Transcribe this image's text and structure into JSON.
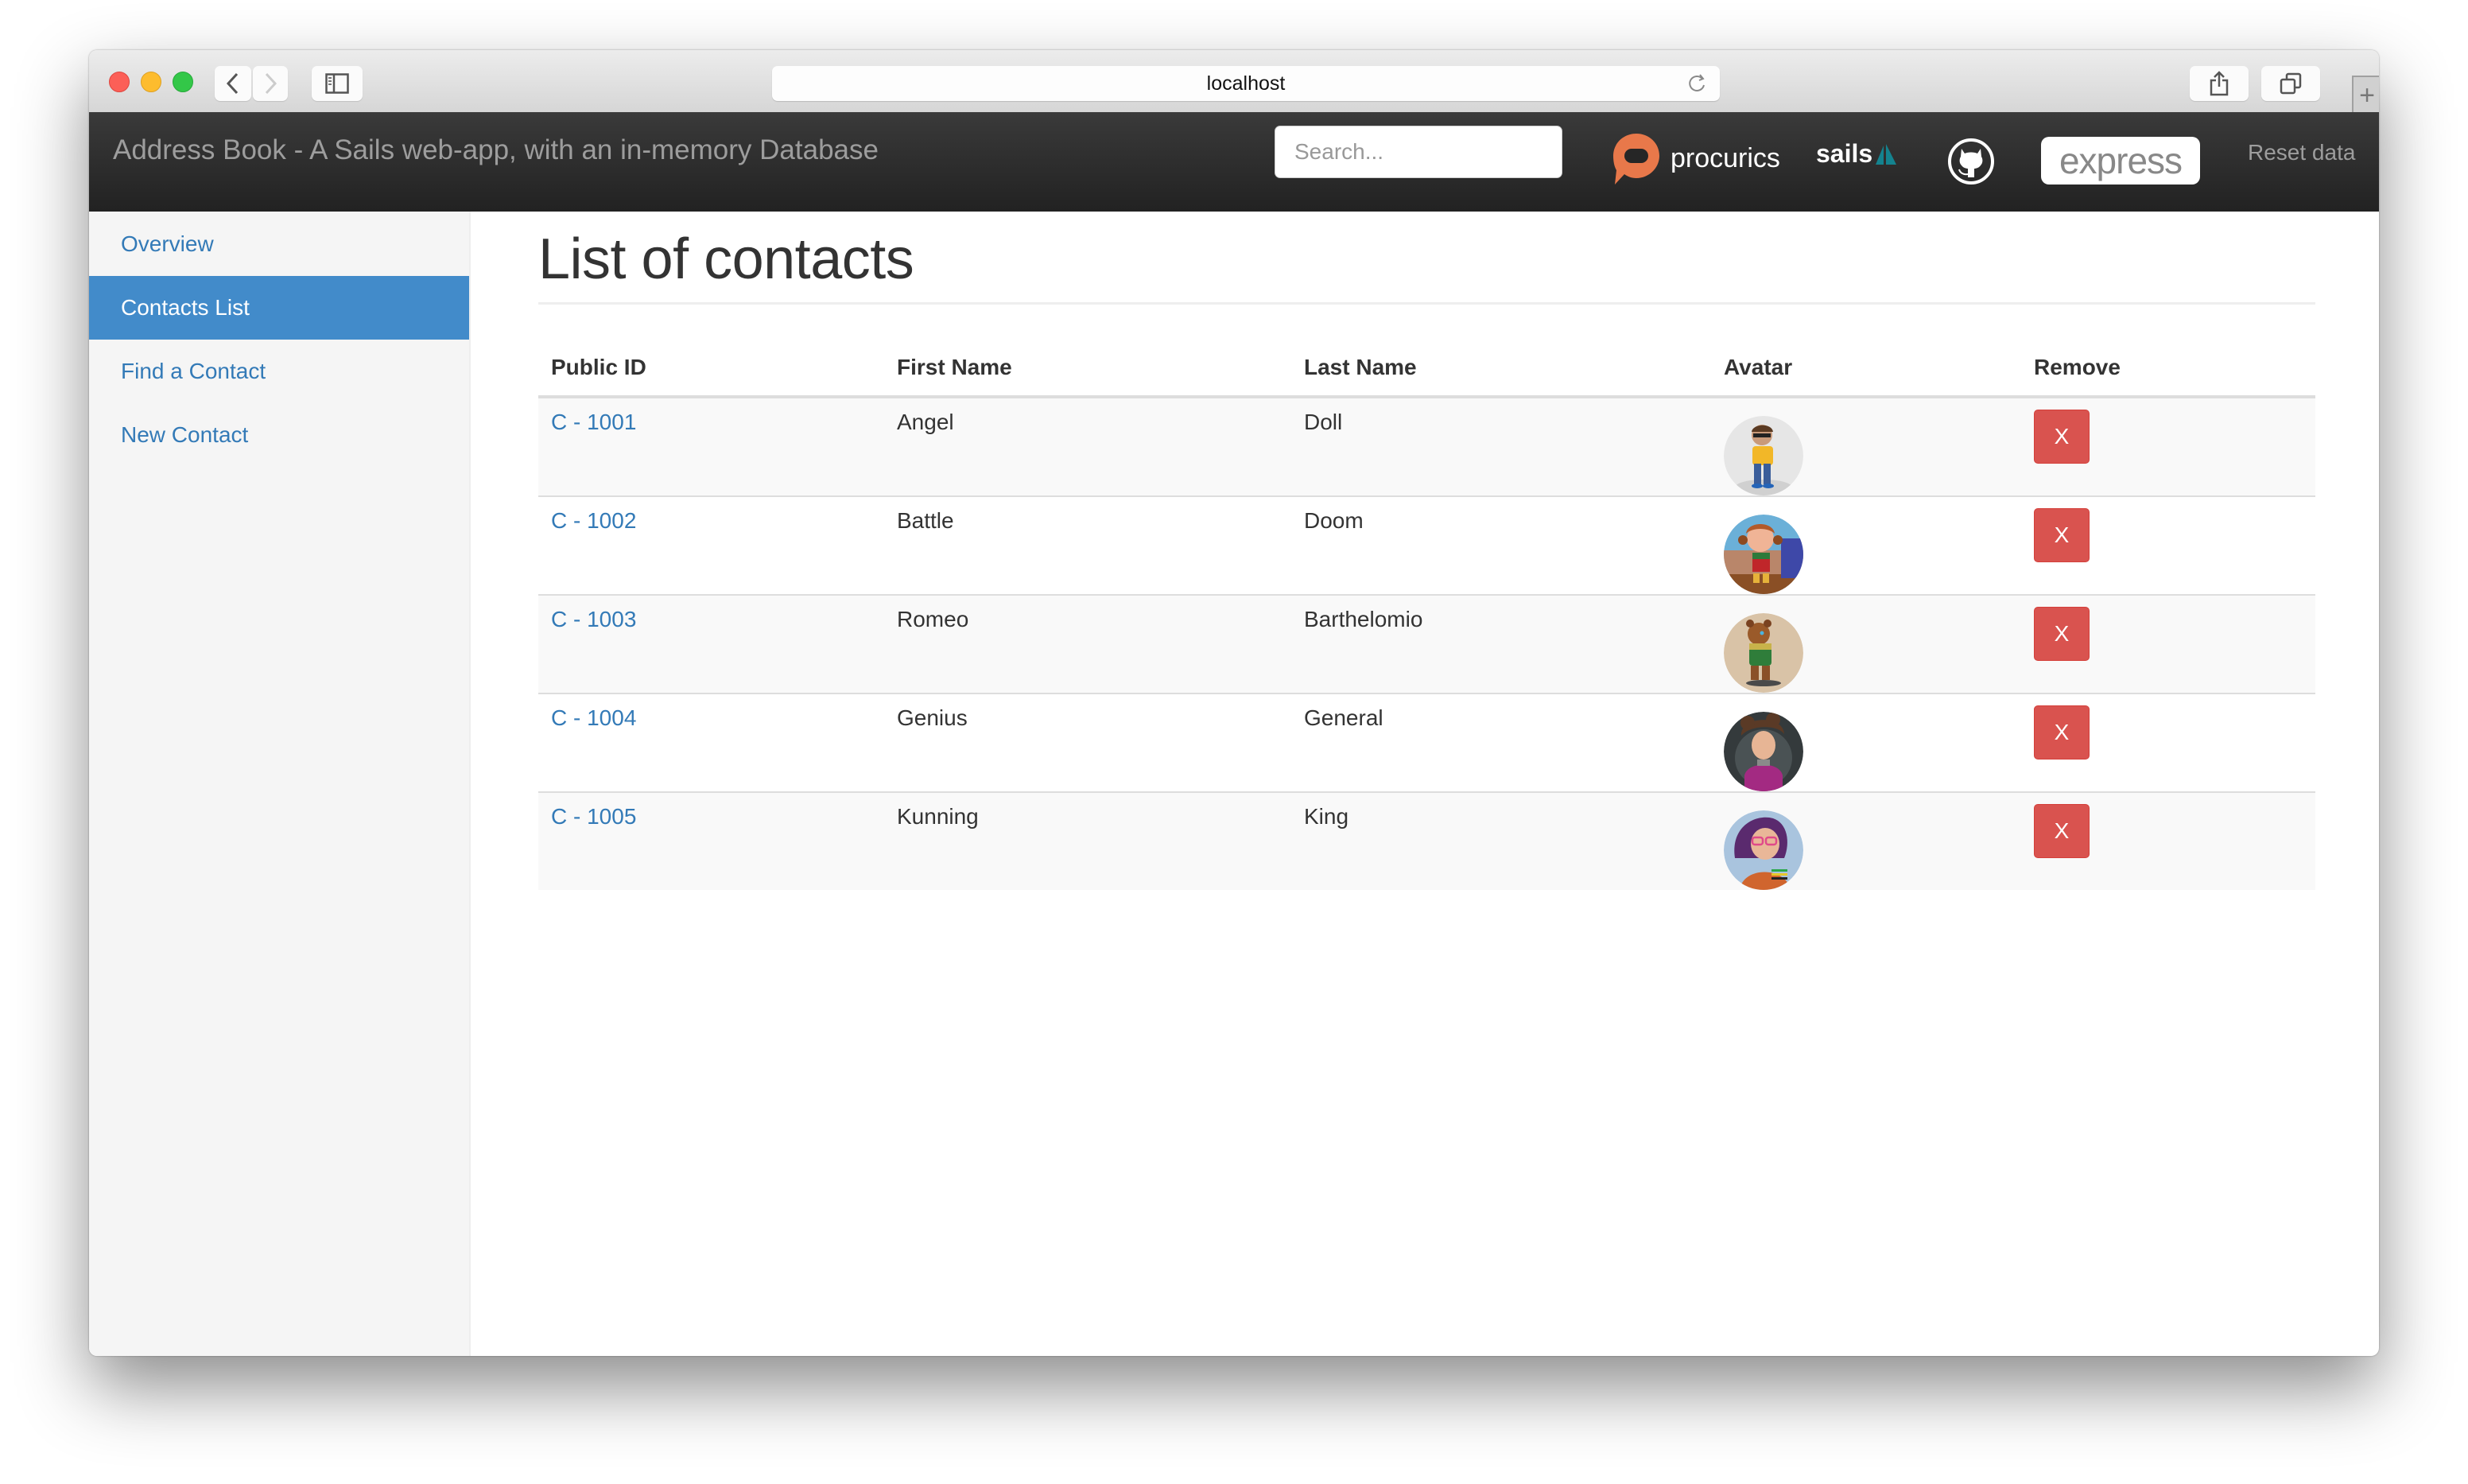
{
  "browser": {
    "url": "localhost",
    "new_tab_label": "+"
  },
  "navbar": {
    "brand": "Address Book - A Sails web-app, with an in-memory Database",
    "search_placeholder": "Search...",
    "search_value": "",
    "logos": {
      "procurics": "procurics",
      "sails": "sails",
      "github": "github",
      "express": "express"
    },
    "reset_label": "Reset data",
    "colors": {
      "procurics_orange": "#e8784a",
      "sails_teal": "#14838f"
    }
  },
  "sidebar": {
    "items": [
      {
        "label": "Overview",
        "active": false
      },
      {
        "label": "Contacts List",
        "active": true
      },
      {
        "label": "Find a Contact",
        "active": false
      },
      {
        "label": "New Contact",
        "active": false
      }
    ],
    "active_color": "#428bca"
  },
  "main": {
    "title": "List of contacts",
    "table": {
      "columns": [
        "Public ID",
        "First Name",
        "Last Name",
        "Avatar",
        "Remove"
      ],
      "rows": [
        {
          "id": "C - 1001",
          "first": "Angel",
          "last": "Doll",
          "avatar": "boy-glasses-yellow-shirt",
          "remove": "X"
        },
        {
          "id": "C - 1002",
          "first": "Battle",
          "last": "Doom",
          "avatar": "girl-pigtails-blue-room",
          "remove": "X"
        },
        {
          "id": "C - 1003",
          "first": "Romeo",
          "last": "Barthelomio",
          "avatar": "bear-green-outfit",
          "remove": "X"
        },
        {
          "id": "C - 1004",
          "first": "Genius",
          "last": "General",
          "avatar": "girl-curly-hair-purple-hoodie",
          "remove": "X"
        },
        {
          "id": "C - 1005",
          "first": "Kunning",
          "last": "King",
          "avatar": "girl-purple-hair-glasses",
          "remove": "X"
        }
      ]
    },
    "remove_button_color": "#d9534f",
    "link_color": "#337ab7"
  }
}
